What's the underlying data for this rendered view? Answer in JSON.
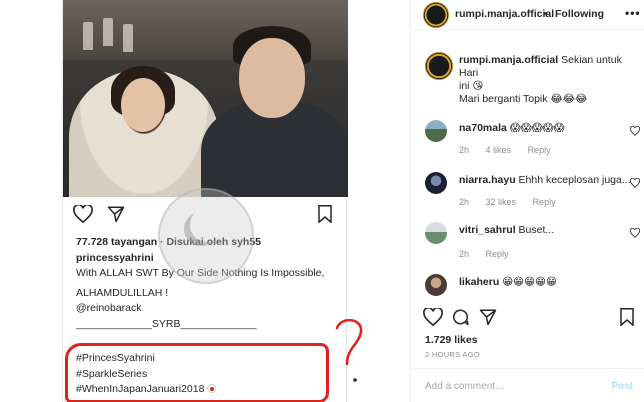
{
  "post": {
    "views_line": "77.728 tayangan · Disukai oleh syh55",
    "author": "princessyahrini",
    "caption_line1": "With ALLAH SWT By Our Side Nothing Is Impossible,",
    "caption_line2": "ALHAMDULILLAH !",
    "mention": "@reinobarack",
    "divider": "_____________SYRB_____________",
    "hashtags": [
      "#PrincesSyahrini",
      "#SparkleSeries",
      "#WhenInJapanJanuari2018"
    ]
  },
  "panel": {
    "header": {
      "username": "rumpi.manja.official",
      "separator": "•",
      "follow_label": "Following",
      "more_label": "•••"
    },
    "caption": {
      "username": "rumpi.manja.official",
      "text_line1": "Sekian untuk Hari",
      "text_line2": "ini 😘",
      "text_line3": "Mari berganti Topik 😂😂😂"
    },
    "comments": [
      {
        "username": "na70mala",
        "text": "😱😱😱😱😱",
        "age": "2h",
        "likes": "4 likes",
        "reply": "Reply"
      },
      {
        "username": "niarra.hayu",
        "text": "Ehhh keceplosan juga...",
        "age": "2h",
        "likes": "32 likes",
        "reply": "Reply"
      },
      {
        "username": "vitri_sahrul",
        "text": "Buset...",
        "age": "2h",
        "likes": "",
        "reply": "Reply"
      },
      {
        "username": "likaheru",
        "text": "😁😁😁😁😁",
        "age": "",
        "likes": "",
        "reply": ""
      }
    ],
    "likes_count": "1.729 likes",
    "time_ago": "2 HOURS AGO",
    "add_comment_placeholder": "Add a comment...",
    "post_label": "Post"
  },
  "colors": {
    "accent_red": "#e0221c",
    "link_blue": "#b2dffc",
    "muted": "#8e8e8e"
  },
  "icons": [
    "heart-icon",
    "send-icon",
    "bookmark-icon",
    "comment-icon",
    "more-icon"
  ]
}
